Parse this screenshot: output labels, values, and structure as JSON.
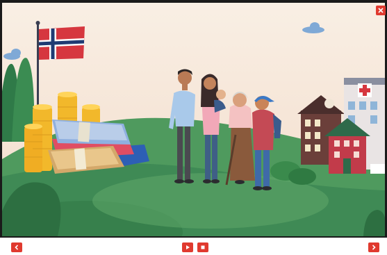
{
  "colors": {
    "accent": "#e03a2f",
    "frame": "#1a1a1a",
    "sky": "#f7e9dc",
    "hill_dark": "#3f8a55",
    "hill_light": "#5fa468",
    "coin": "#f2b82b",
    "flag_red": "#d6373f",
    "flag_blue": "#1f3b73"
  },
  "player": {
    "controls": [
      {
        "id": "close",
        "icon": "close-icon"
      },
      {
        "id": "prev",
        "icon": "chevron-left-icon"
      },
      {
        "id": "play",
        "icon": "play-icon"
      },
      {
        "id": "stop",
        "icon": "stop-icon"
      },
      {
        "id": "next",
        "icon": "chevron-right-icon"
      }
    ]
  },
  "scene": {
    "elements": [
      "norwegian-flag",
      "money-pile",
      "family-group",
      "school-building",
      "hospital-building",
      "clouds",
      "hills"
    ]
  }
}
